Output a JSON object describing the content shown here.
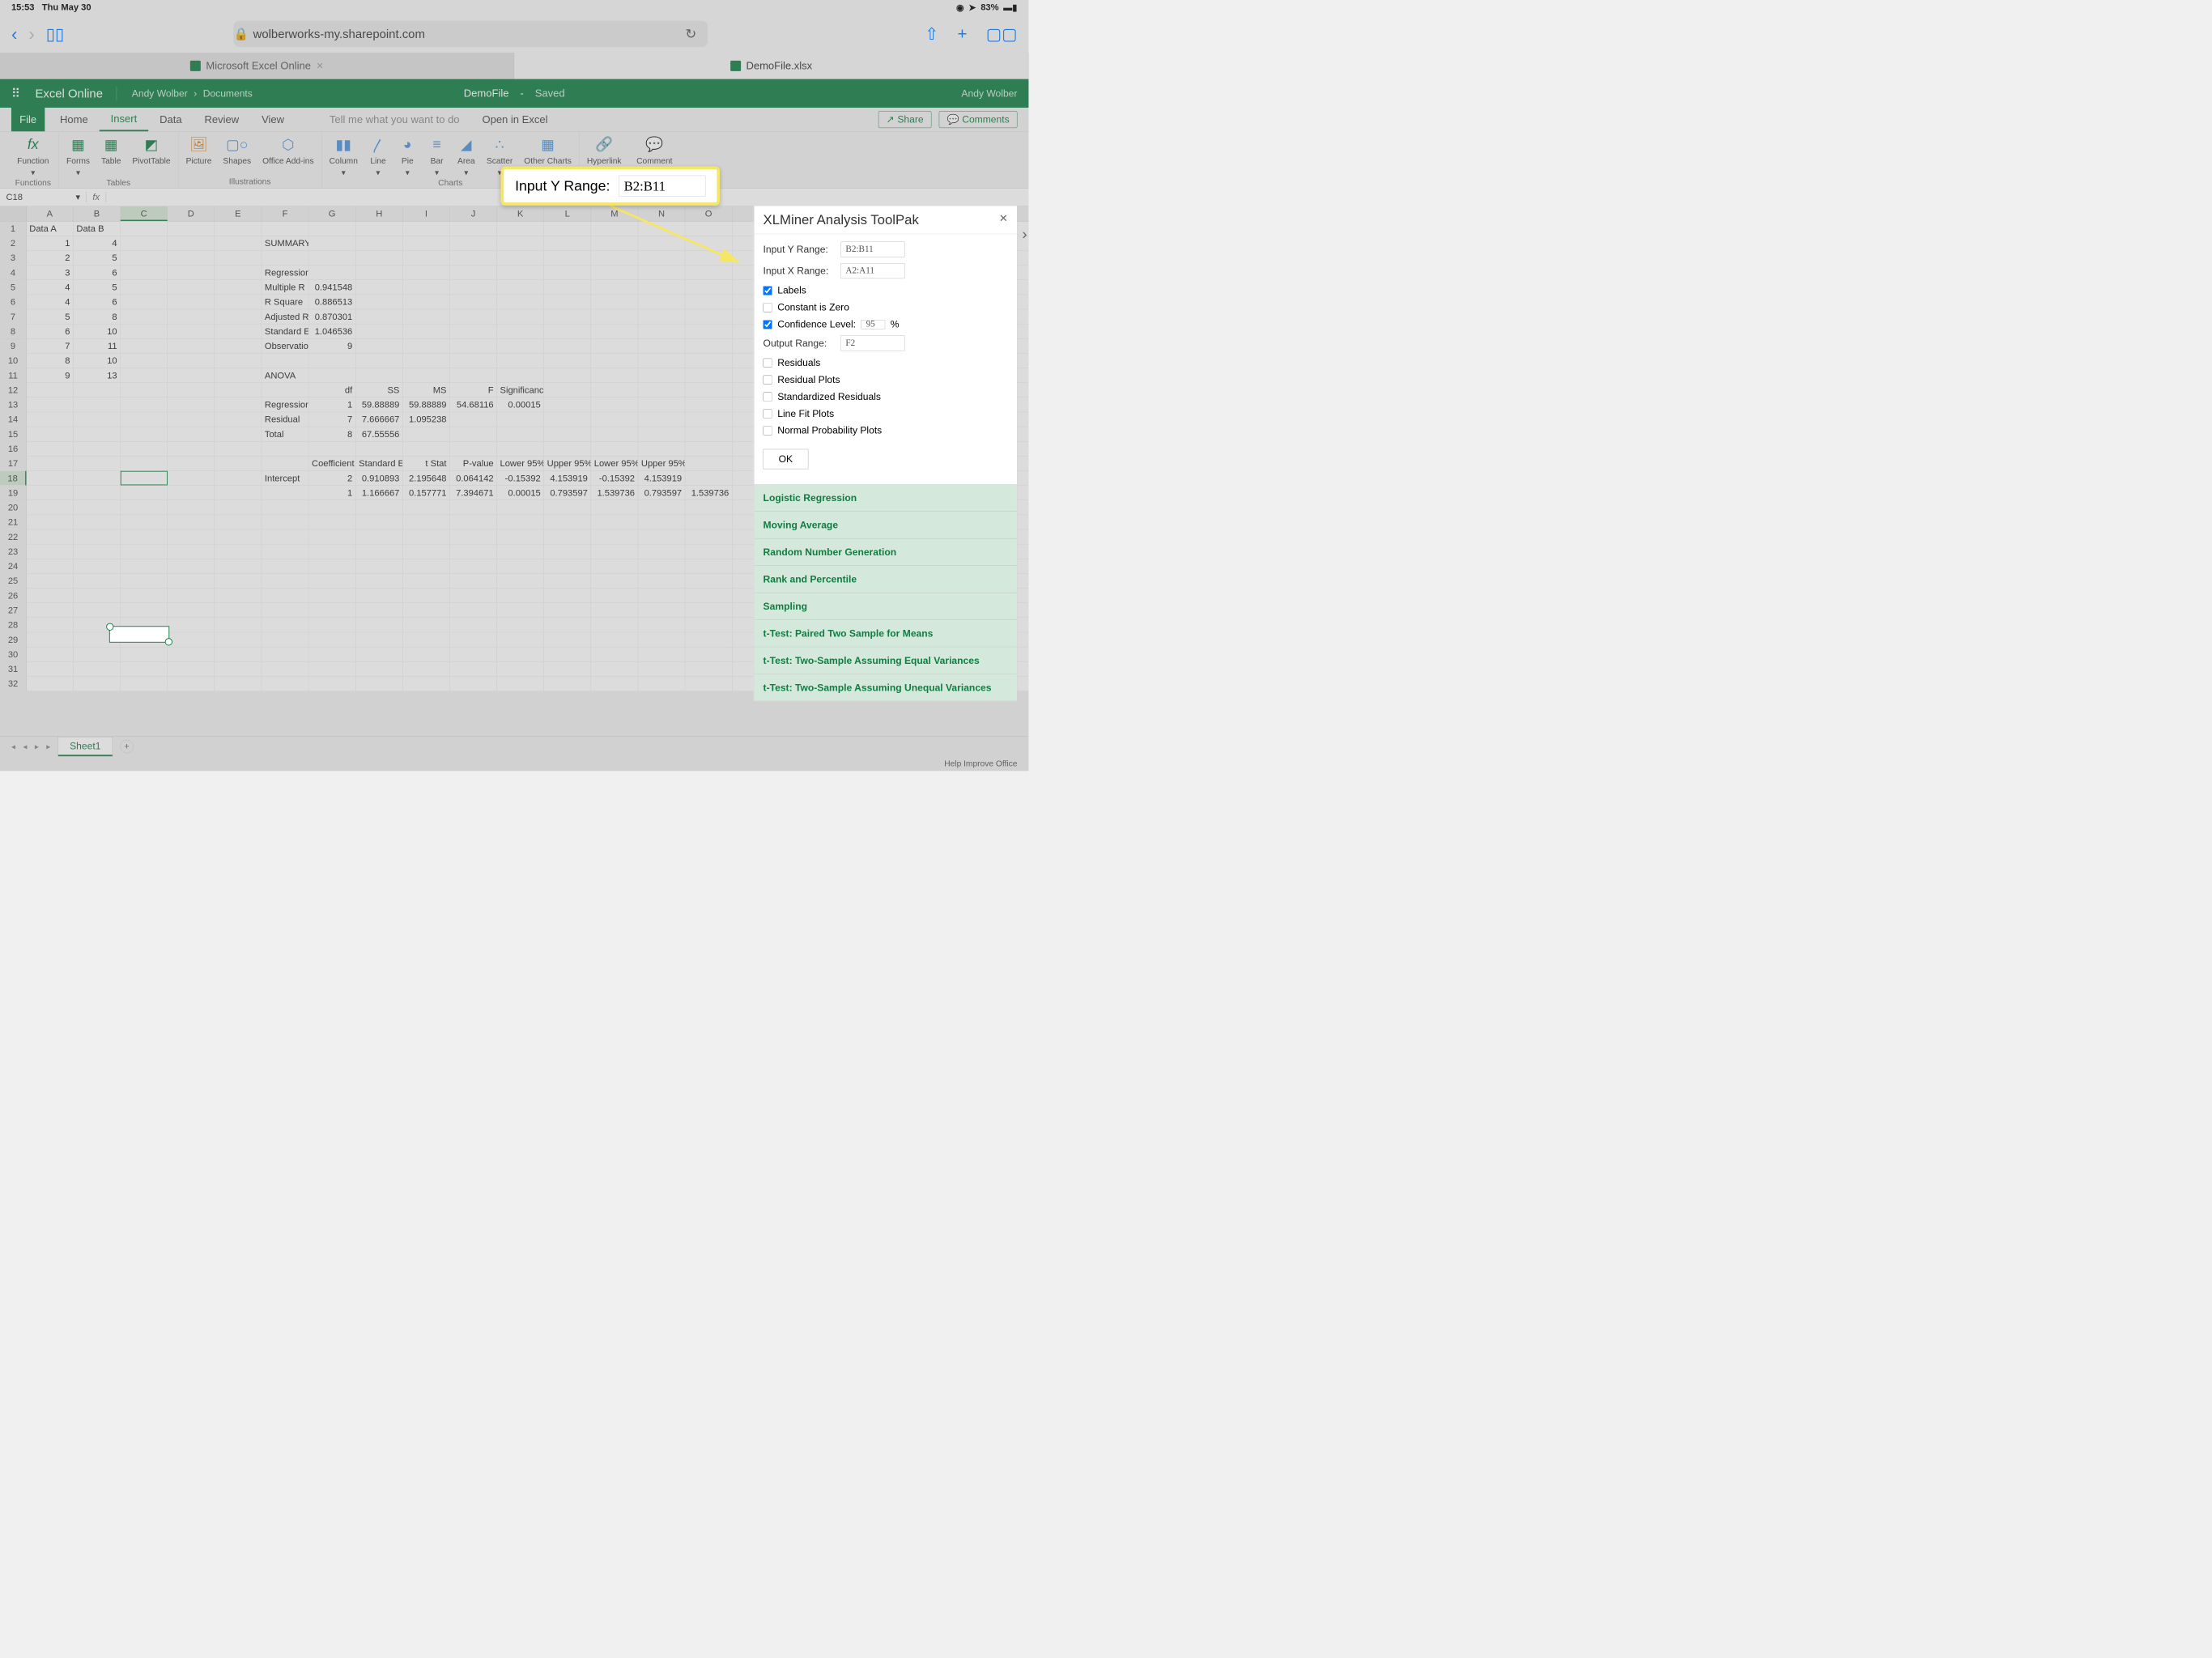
{
  "status": {
    "time": "15:53",
    "date": "Thu May 30",
    "battery": "83%"
  },
  "browser": {
    "url": "wolberworks-my.sharepoint.com"
  },
  "tabs": [
    {
      "label": "Microsoft Excel Online",
      "active": false
    },
    {
      "label": "DemoFile.xlsx",
      "active": true
    }
  ],
  "header": {
    "app": "Excel Online",
    "user": "Andy Wolber",
    "bc1": "Andy Wolber",
    "bc2": "Documents",
    "doc": "DemoFile",
    "saved": "Saved"
  },
  "ribbon_tabs": [
    "File",
    "Home",
    "Insert",
    "Data",
    "Review",
    "View"
  ],
  "ribbon_tell": "Tell me what you want to do",
  "ribbon_open": "Open in Excel",
  "share": "Share",
  "comments": "Comments",
  "ribbon_groups": {
    "functions": {
      "label": "Functions",
      "items": [
        "Function"
      ]
    },
    "tables": {
      "label": "Tables",
      "items": [
        "Forms",
        "Table",
        "PivotTable"
      ]
    },
    "illustrations": {
      "label": "Illustrations",
      "items": [
        "Picture",
        "Shapes",
        "Office Add-ins"
      ]
    },
    "charts": {
      "label": "Charts",
      "items": [
        "Column",
        "Line",
        "Pie",
        "Bar",
        "Area",
        "Scatter",
        "Other Charts"
      ]
    },
    "links": {
      "label": "",
      "items": [
        "Hyperlink"
      ]
    },
    "comment": {
      "label": "",
      "items": [
        "Comment"
      ]
    }
  },
  "name_box": "C18",
  "cols": [
    "A",
    "B",
    "C",
    "D",
    "E",
    "F",
    "G",
    "H",
    "I",
    "J",
    "K",
    "L",
    "M",
    "N",
    "O"
  ],
  "callout": {
    "label": "Input Y Range:",
    "value": "B2:B11"
  },
  "data": {
    "headers": [
      "Data A",
      "Data B"
    ],
    "a": [
      1,
      2,
      3,
      4,
      4,
      5,
      6,
      7,
      8,
      9
    ],
    "b": [
      4,
      5,
      6,
      5,
      6,
      8,
      10,
      11,
      10,
      13
    ],
    "summary": "SUMMARY OUTPUT",
    "reg_title": "Regression Statistics",
    "reg": [
      [
        "Multiple R",
        "0.941548"
      ],
      [
        "R Square",
        "0.886513"
      ],
      [
        "Adjusted R",
        "0.870301"
      ],
      [
        "Standard E",
        "1.046536"
      ],
      [
        "Observatio",
        "9"
      ]
    ],
    "anova": "ANOVA",
    "anova_h": [
      "",
      "df",
      "SS",
      "MS",
      "F",
      "Significance F"
    ],
    "anova_r": [
      [
        "Regression",
        "1",
        "59.88889",
        "59.88889",
        "54.68116",
        "0.00015"
      ],
      [
        "Residual",
        "7",
        "7.666667",
        "1.095238",
        "",
        ""
      ],
      [
        "Total",
        "8",
        "67.55556",
        "",
        "",
        ""
      ]
    ],
    "coef_h": [
      "",
      "Coefficient",
      "Standard E",
      "t Stat",
      "P-value",
      "Lower 95%",
      "Upper 95%",
      "Lower 95%",
      "Upper 95%"
    ],
    "coef_r": [
      [
        "Intercept",
        "2",
        "0.910893",
        "2.195648",
        "0.064142",
        "-0.15392",
        "4.153919",
        "-0.15392",
        "4.153919"
      ],
      [
        "",
        "1",
        "1.166667",
        "0.157771",
        "7.394671",
        "0.00015",
        "0.793597",
        "1.539736",
        "0.793597",
        "1.539736"
      ]
    ]
  },
  "sidepanel": {
    "title": "XLMiner Analysis ToolPak",
    "y_label": "Input Y Range:",
    "y_val": "B2:B11",
    "x_label": "Input X Range:",
    "x_val": "A2:A11",
    "labels": "Labels",
    "const_zero": "Constant is Zero",
    "conf_label": "Confidence Level:",
    "conf_val": "95",
    "conf_pct": "%",
    "out_label": "Output Range:",
    "out_val": "F2",
    "residuals": "Residuals",
    "res_plots": "Residual Plots",
    "std_res": "Standardized Residuals",
    "linefit": "Line Fit Plots",
    "normprob": "Normal Probability Plots",
    "ok": "OK",
    "list": [
      "Logistic Regression",
      "Moving Average",
      "Random Number Generation",
      "Rank and Percentile",
      "Sampling",
      "t-Test: Paired Two Sample for Means",
      "t-Test: Two-Sample Assuming Equal Variances",
      "t-Test: Two-Sample Assuming Unequal Variances"
    ]
  },
  "sheet": "Sheet1",
  "footer": "Help Improve Office"
}
